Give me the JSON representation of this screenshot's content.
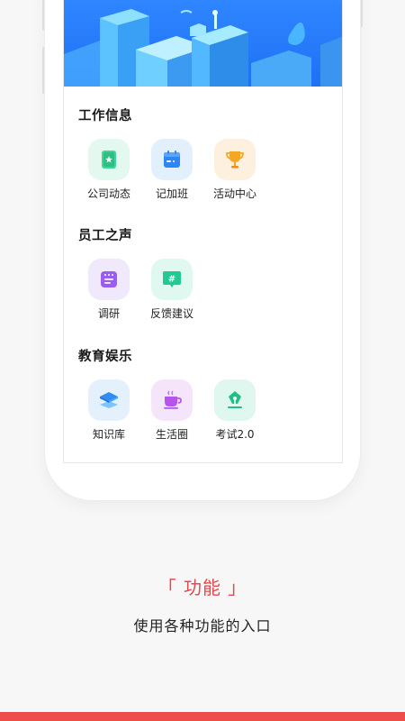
{
  "sections": [
    {
      "title": "工作信息",
      "items": [
        {
          "label": "公司动态",
          "icon": "company-news-icon"
        },
        {
          "label": "记加班",
          "icon": "overtime-calendar-icon"
        },
        {
          "label": "活动中心",
          "icon": "trophy-icon"
        }
      ]
    },
    {
      "title": "员工之声",
      "items": [
        {
          "label": "调研",
          "icon": "survey-icon"
        },
        {
          "label": "反馈建议",
          "icon": "feedback-hashtag-icon"
        }
      ]
    },
    {
      "title": "教育娱乐",
      "items": [
        {
          "label": "知识库",
          "icon": "knowledge-layers-icon"
        },
        {
          "label": "生活圈",
          "icon": "coffee-cup-icon"
        },
        {
          "label": "考试2.0",
          "icon": "exam-pen-icon"
        }
      ]
    }
  ],
  "feature": {
    "title": "「 功能 」",
    "description": "使用各种功能的入口"
  },
  "colors": {
    "accent": "#ee4d4d",
    "title_red": "#e5484d",
    "banner_blue": "#2f86ff"
  }
}
